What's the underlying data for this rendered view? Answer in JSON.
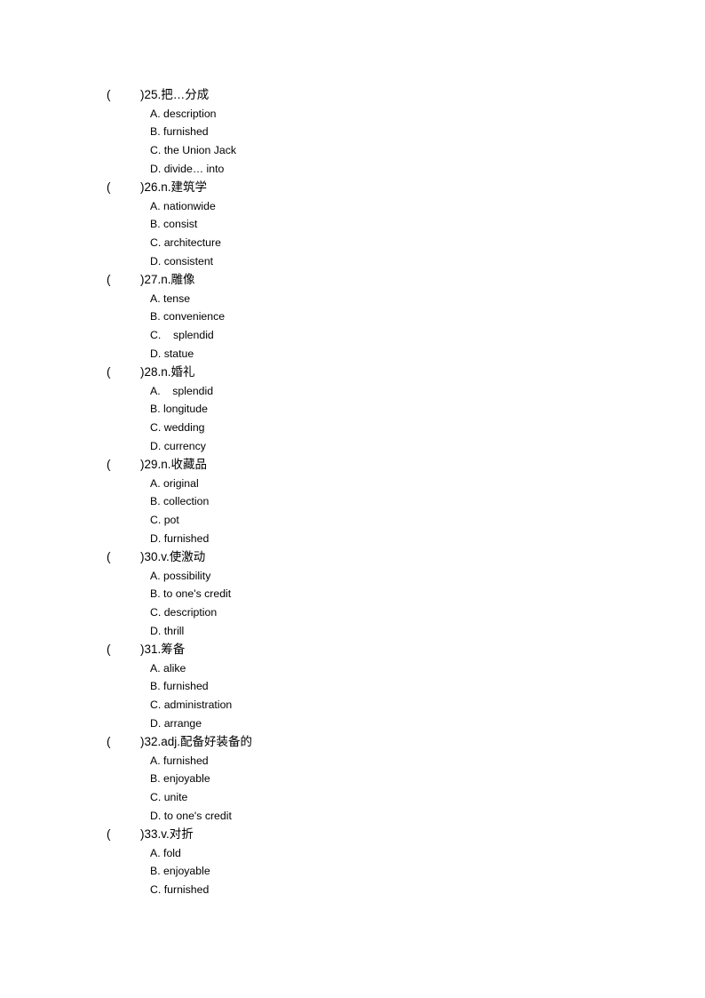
{
  "questions": [
    {
      "number": "25",
      "paren_open": "(",
      "stem": ")25.把…分成",
      "options": [
        "A. description",
        "B. furnished",
        "C. the Union Jack",
        "D. divide… into"
      ]
    },
    {
      "number": "26",
      "paren_open": "(",
      "stem": ")26.n.建筑学",
      "options": [
        "A. nationwide",
        "B. consist",
        "C. architecture",
        "D. consistent"
      ]
    },
    {
      "number": "27",
      "paren_open": "(",
      "stem": ")27.n.雕像",
      "options": [
        "A. tense",
        "B. convenience",
        "C.    splendid",
        "D. statue"
      ]
    },
    {
      "number": "28",
      "paren_open": "(",
      "stem": ")28.n.婚礼",
      "options": [
        "A.    splendid",
        "B. longitude",
        "C. wedding",
        "D. currency"
      ]
    },
    {
      "number": "29",
      "paren_open": "(",
      "stem": ")29.n.收藏品",
      "options": [
        "A. original",
        "B. collection",
        "C. pot",
        "D. furnished"
      ]
    },
    {
      "number": "30",
      "paren_open": "(",
      "stem": ")30.v.使激动",
      "options": [
        "A. possibility",
        "B. to one's credit",
        "C. description",
        "D. thrill"
      ]
    },
    {
      "number": "31",
      "paren_open": "(",
      "stem": ")31.筹备",
      "options": [
        "A. alike",
        "B. furnished",
        "C. administration",
        "D. arrange"
      ]
    },
    {
      "number": "32",
      "paren_open": "(",
      "stem": ")32.adj.配备好装备的",
      "options": [
        "A. furnished",
        "B. enjoyable",
        "C. unite",
        "D. to one's credit"
      ]
    },
    {
      "number": "33",
      "paren_open": "(",
      "stem": ")33.v.对折",
      "options": [
        "A. fold",
        "B. enjoyable",
        "C. furnished"
      ]
    }
  ]
}
